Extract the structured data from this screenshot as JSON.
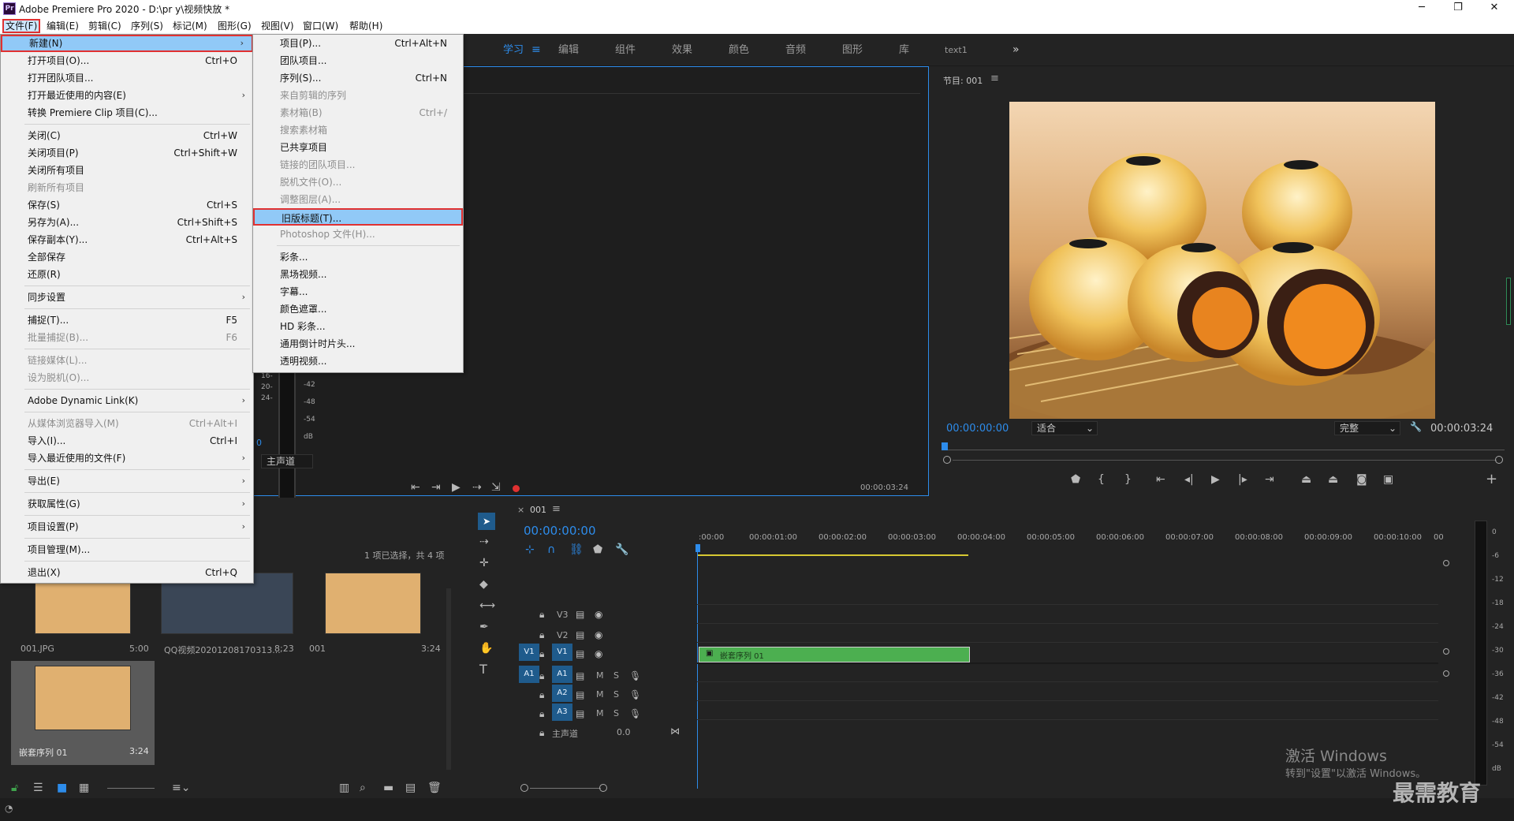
{
  "app": {
    "title": "Adobe Premiere Pro 2020 - D:\\pr y\\视频快放 *",
    "logo": "Pr",
    "win_minimize": "minimize-icon",
    "win_maximize": "restore-icon",
    "win_close": "close-icon"
  },
  "menubar": [
    "文件(F)",
    "编辑(E)",
    "剪辑(C)",
    "序列(S)",
    "标记(M)",
    "图形(G)",
    "视图(V)",
    "窗口(W)",
    "帮助(H)"
  ],
  "workspaces": [
    "学习",
    "编辑",
    "组件",
    "效果",
    "颜色",
    "音频",
    "图形",
    "库",
    "text1"
  ],
  "file_menu": [
    {
      "label": "新建(N)",
      "shortcut": "",
      "arrow": true,
      "state": "hl"
    },
    {
      "label": "打开项目(O)...",
      "shortcut": "Ctrl+O"
    },
    {
      "label": "打开团队项目..."
    },
    {
      "label": "打开最近使用的内容(E)",
      "arrow": true
    },
    {
      "label": "转换 Premiere Clip 项目(C)..."
    },
    {
      "sep": true
    },
    {
      "label": "关闭(C)",
      "shortcut": "Ctrl+W"
    },
    {
      "label": "关闭项目(P)",
      "shortcut": "Ctrl+Shift+W"
    },
    {
      "label": "关闭所有项目"
    },
    {
      "label": "刷新所有项目",
      "state": "dis"
    },
    {
      "label": "保存(S)",
      "shortcut": "Ctrl+S"
    },
    {
      "label": "另存为(A)...",
      "shortcut": "Ctrl+Shift+S"
    },
    {
      "label": "保存副本(Y)...",
      "shortcut": "Ctrl+Alt+S"
    },
    {
      "label": "全部保存"
    },
    {
      "label": "还原(R)"
    },
    {
      "sep": true
    },
    {
      "label": "同步设置",
      "arrow": true
    },
    {
      "sep": true
    },
    {
      "label": "捕捉(T)...",
      "shortcut": "F5"
    },
    {
      "label": "批量捕捉(B)...",
      "shortcut": "F6",
      "state": "dis"
    },
    {
      "sep": true
    },
    {
      "label": "链接媒体(L)...",
      "state": "dis"
    },
    {
      "label": "设为脱机(O)...",
      "state": "dis"
    },
    {
      "sep": true
    },
    {
      "label": "Adobe Dynamic Link(K)",
      "arrow": true
    },
    {
      "sep": true
    },
    {
      "label": "从媒体浏览器导入(M)",
      "shortcut": "Ctrl+Alt+I",
      "state": "dis"
    },
    {
      "label": "导入(I)...",
      "shortcut": "Ctrl+I"
    },
    {
      "label": "导入最近使用的文件(F)",
      "arrow": true
    },
    {
      "sep": true
    },
    {
      "label": "导出(E)",
      "arrow": true
    },
    {
      "sep": true
    },
    {
      "label": "获取属性(G)",
      "arrow": true
    },
    {
      "sep": true
    },
    {
      "label": "项目设置(P)",
      "arrow": true
    },
    {
      "sep": true
    },
    {
      "label": "项目管理(M)..."
    },
    {
      "sep": true
    },
    {
      "label": "退出(X)",
      "shortcut": "Ctrl+Q"
    }
  ],
  "new_submenu": [
    {
      "label": "项目(P)...",
      "shortcut": "Ctrl+Alt+N"
    },
    {
      "label": "团队项目..."
    },
    {
      "label": "序列(S)...",
      "shortcut": "Ctrl+N"
    },
    {
      "label": "来自剪辑的序列",
      "state": "dis"
    },
    {
      "label": "素材箱(B)",
      "shortcut": "Ctrl+/",
      "state": "dis"
    },
    {
      "label": "搜索素材箱",
      "state": "dis"
    },
    {
      "label": "已共享项目"
    },
    {
      "label": "链接的团队项目...",
      "state": "dis"
    },
    {
      "label": "脱机文件(O)...",
      "state": "dis"
    },
    {
      "label": "调整图层(A)...",
      "state": "dis"
    },
    {
      "label": "旧版标题(T)...",
      "state": "box"
    },
    {
      "label": "Photoshop 文件(H)...",
      "state": "dis"
    },
    {
      "sep": true
    },
    {
      "label": "彩条..."
    },
    {
      "label": "黑场视频..."
    },
    {
      "label": "字幕..."
    },
    {
      "label": "颜色遮罩..."
    },
    {
      "label": "HD 彩条..."
    },
    {
      "label": "通用倒计时片头..."
    },
    {
      "label": "透明视频..."
    }
  ],
  "source": {
    "timecode_end": "00:00:03:24",
    "audio_label": "主声道",
    "meter_labels": [
      "-42",
      "-48",
      "-54",
      "dB"
    ],
    "meter_left": [
      "16-",
      "20-",
      "24-"
    ],
    "zero": "0"
  },
  "program": {
    "title": "节目: 001",
    "timecode_current": "00:00:00:00",
    "timecode_end": "00:00:03:24",
    "fit": "适合",
    "quality": "完整"
  },
  "project": {
    "selection_text": "1 项已选择，共 4 项",
    "items": [
      {
        "name": "001.JPG",
        "duration": "5:00"
      },
      {
        "name": "QQ视频20201208170313...",
        "duration": "8;23"
      },
      {
        "name": "001",
        "duration": "3:24"
      },
      {
        "name": "嵌套序列 01",
        "duration": "3:24"
      }
    ]
  },
  "timeline": {
    "tab": "001",
    "timecode": "00:00:00:00",
    "ruler": [
      ":00:00",
      "00:00:01:00",
      "00:00:02:00",
      "00:00:03:00",
      "00:00:04:00",
      "00:00:05:00",
      "00:00:06:00",
      "00:00:07:00",
      "00:00:08:00",
      "00:00:09:00",
      "00:00:10:00",
      "00"
    ],
    "video_tracks": [
      "V3",
      "V2",
      "V1"
    ],
    "audio_tracks": [
      "A1",
      "A2",
      "A3"
    ],
    "src_v": "V1",
    "src_a": "A1",
    "master": "主声道",
    "master_val": "0.0",
    "m": "M",
    "s": "S",
    "clip": "嵌套序列 01"
  },
  "meter": {
    "labels": [
      "0",
      "-6",
      "-12",
      "-18",
      "-24",
      "-30",
      "-36",
      "-42",
      "-48",
      "-54",
      "dB"
    ]
  },
  "watermark": {
    "line1": "激活 Windows",
    "line2": "转到\"设置\"以激活 Windows。",
    "brand": "最需教育"
  }
}
